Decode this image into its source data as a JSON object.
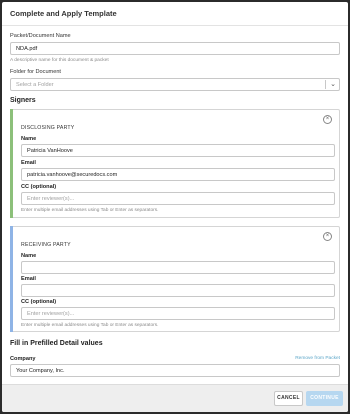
{
  "modal": {
    "title": "Complete and Apply Template"
  },
  "packet": {
    "label": "Packet/Document Name",
    "value": "NDA.pdf",
    "help": "A descriptive name for this document & packet"
  },
  "folder": {
    "label": "Folder for Document",
    "placeholder": "Select a Folder",
    "chevron": "⌄"
  },
  "signers": {
    "title": "Signers",
    "parties": [
      {
        "role": "DISCLOSING PARTY",
        "accent": "#8cc07a",
        "name_label": "Name",
        "name_value": "Patricia VanHoove",
        "email_label": "Email",
        "email_value": "patricia.vanhoove@securedocs.com",
        "cc_label": "CC (optional)",
        "cc_placeholder": "Enter reviewer(s)...",
        "cc_help": "Enter multiple email addresses using Tab or Enter as separators.",
        "close": "×"
      },
      {
        "role": "RECEIVING PARTY",
        "accent": "#8fb4e6",
        "name_label": "Name",
        "name_value": "",
        "email_label": "Email",
        "email_value": "",
        "cc_label": "CC (optional)",
        "cc_placeholder": "Enter reviewer(s)...",
        "cc_help": "Enter multiple email addresses using Tab or Enter as separators.",
        "close": "×"
      }
    ]
  },
  "prefilled": {
    "title": "Fill in Prefilled Detail values",
    "company_label": "Company",
    "remove_link": "Remove from Packet",
    "company_value": "Your Company, Inc."
  },
  "footer": {
    "cancel": "CANCEL",
    "continue": "CONTINUE"
  }
}
